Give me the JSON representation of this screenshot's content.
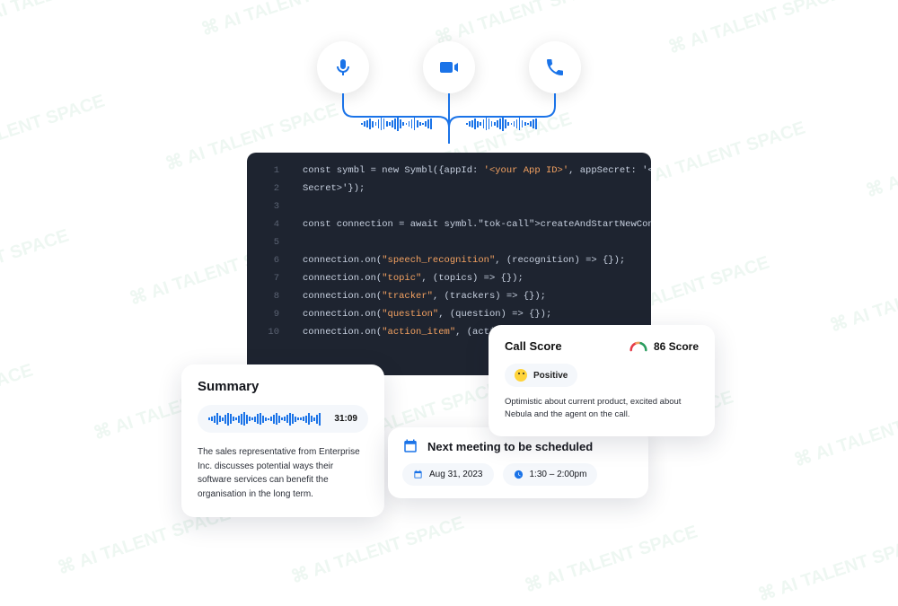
{
  "input_sources": [
    "microphone",
    "video",
    "phone"
  ],
  "code": {
    "lines": [
      "const symbl = new Symbl({appId: '<your App ID>', appSecret: '<your App",
      "Secret>'});",
      "",
      "const connection = await symbl.createAndStartNewConnection();",
      "",
      "connection.on(\"speech_recognition\", (recognition) => {});",
      "connection.on(\"topic\", (topics) => {});",
      "connection.on(\"tracker\", (trackers) => {});",
      "connection.on(\"question\", (question) => {});",
      "connection.on(\"action_item\", (action_item) => {});"
    ]
  },
  "summary": {
    "title": "Summary",
    "duration": "31:09",
    "text": "The sales representative from Enterprise Inc. discusses potential ways their software services can benefit the organisation in the long term."
  },
  "meeting": {
    "title": "Next meeting to be scheduled",
    "date": "Aug 31, 2023",
    "time": "1:30 – 2:00pm"
  },
  "score": {
    "title": "Call Score",
    "value": "86 Score",
    "sentiment_label": "Positive",
    "sentiment_text": "Optimistic about current product, excited about Nebula and the agent on the call."
  },
  "watermark_text": "AI TALENT SPACE"
}
